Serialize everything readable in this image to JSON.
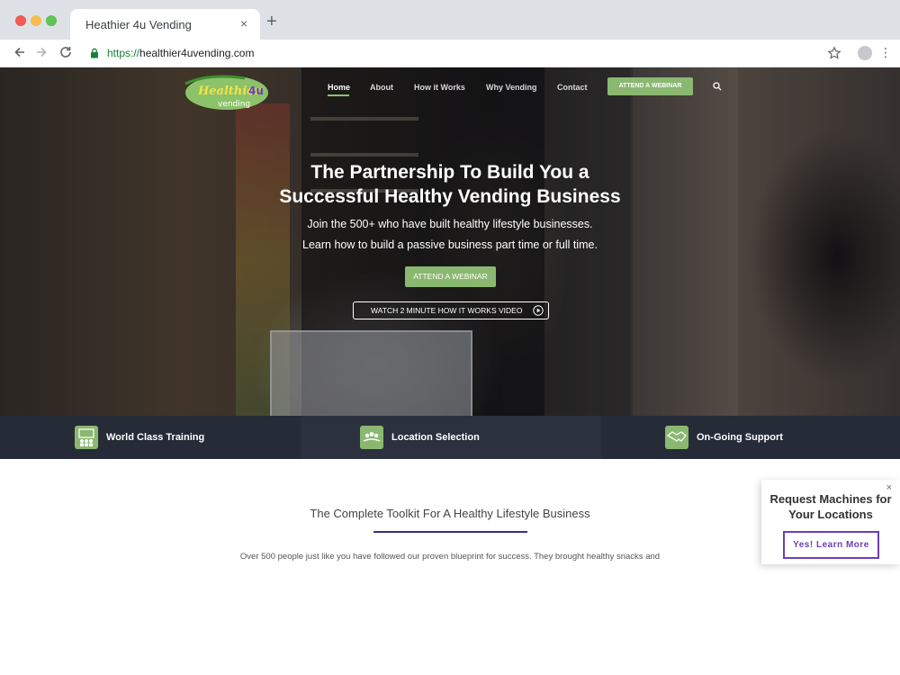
{
  "browser": {
    "tab_title": "Heathier 4u Vending",
    "tab_close": "×",
    "new_tab": "+",
    "url_scheme": "https://",
    "url_host": "healthier4uvending.com",
    "kebab": "⋮"
  },
  "logo": {
    "line1": "Healthier",
    "mark": "4u",
    "line2": "vending"
  },
  "nav": {
    "items": [
      {
        "label": "Home"
      },
      {
        "label": "About"
      },
      {
        "label": "How it Works"
      },
      {
        "label": "Why Vending"
      },
      {
        "label": "Contact"
      }
    ],
    "cta": "ATTEND A WEBINAR"
  },
  "hero": {
    "title_line1": "The Partnership To Build You a",
    "title_line2": "Successful Healthy Vending Business",
    "sub1": "Join the 500+ who have built healthy lifestyle businesses.",
    "sub2": "Learn how to build a passive business part time or full time.",
    "cta": "ATTEND A WEBINAR",
    "video": "WATCH 2 MINUTE HOW IT WORKS VIDEO"
  },
  "features": [
    {
      "label": "World Class Training",
      "icon": "training-icon"
    },
    {
      "label": "Location Selection",
      "icon": "location-icon"
    },
    {
      "label": "On-Going Support",
      "icon": "handshake-icon"
    }
  ],
  "content": {
    "title": "The Complete Toolkit For A Healthy Lifestyle Business",
    "body": "Over 500 people just like you have followed our proven blueprint for success. They brought healthy snacks and"
  },
  "popup": {
    "close": "×",
    "title_line1": "Request Machines for",
    "title_line2": "Your Locations",
    "button": "Yes! Learn More"
  },
  "colors": {
    "accent_green": "#8ab870",
    "brand_purple": "#6a3fb8",
    "strip_dark": "#262b38"
  }
}
